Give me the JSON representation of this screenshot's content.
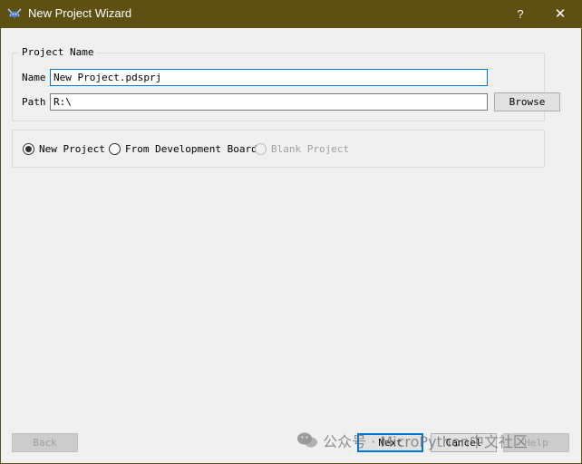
{
  "window": {
    "title": "New Project Wizard",
    "help_glyph": "?",
    "close_glyph": "✕",
    "app_icon": "proteus-icon"
  },
  "project_group": {
    "title": "Project Name",
    "name_label": "Name",
    "name_value": "New Project.pdsprj",
    "path_label": "Path",
    "path_value": "R:\\",
    "browse_label": "Browse"
  },
  "options": [
    {
      "label": "New Project",
      "checked": true,
      "enabled": true
    },
    {
      "label": "From Development Board",
      "checked": false,
      "enabled": true
    },
    {
      "label": "Blank Project",
      "checked": false,
      "enabled": false
    }
  ],
  "footer": {
    "back_label": "Back",
    "next_label": "Next",
    "cancel_label": "Cancel",
    "help_label": "Help"
  },
  "watermark": {
    "text": "公众号 · MicroPython中文社区",
    "icon": "wechat-icon"
  },
  "colors": {
    "titlebar": "#5e5012",
    "dialog_bg": "#f0f0f0",
    "focus_border": "#0078d7"
  }
}
